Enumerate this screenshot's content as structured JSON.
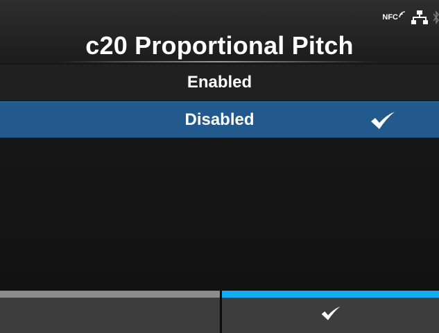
{
  "header": {
    "title": "c20 Proportional Pitch",
    "status_icons": {
      "nfc_label": "NFC",
      "network_icon": "network-icon",
      "bluetooth_icon": "bluetooth-icon"
    }
  },
  "options": [
    {
      "label": "Enabled",
      "selected": false
    },
    {
      "label": "Disabled",
      "selected": true,
      "checked": true
    }
  ],
  "softkeys": {
    "left": {
      "label": "",
      "bar_color": "#8c8c8c"
    },
    "right": {
      "icon": "check-icon",
      "bar_color": "#12aef5"
    }
  },
  "colors": {
    "selected_row": "#235a8d",
    "softkey_accent": "#12aef5",
    "background": "#141414"
  }
}
